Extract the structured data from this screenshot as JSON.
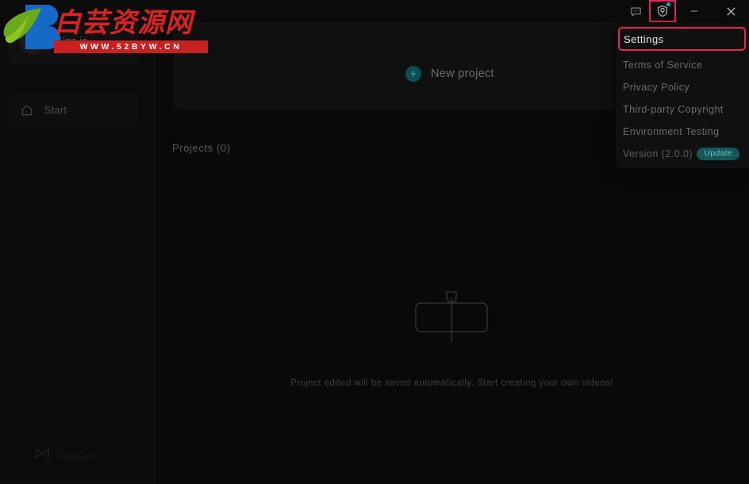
{
  "window": {
    "titlebar": {
      "feedback_icon": "chat-bubble-icon",
      "help_icon": "help-shield-icon",
      "minimize_label": "—",
      "close_label": "✕",
      "help_has_notification": true
    }
  },
  "sidebar": {
    "account": {
      "label": "Sign in",
      "avatar_icon": "avatar-icon"
    },
    "items": [
      {
        "label": "Start",
        "icon": "home-icon",
        "active": true
      }
    ],
    "footer_brand": {
      "label": "CapCut",
      "icon": "capcut-logo-icon"
    }
  },
  "main": {
    "new_project": {
      "label": "New project",
      "icon": "plus-circle-icon"
    },
    "projects_header": "Projects (0)",
    "empty_state": {
      "icon": "empty-project-icon",
      "message": "Project edited will be saved automatically. Start creating your own videos!"
    }
  },
  "dropdown": {
    "items": [
      {
        "label": "Settings",
        "highlighted": true
      },
      {
        "label": "Terms of Service",
        "highlighted": false
      },
      {
        "label": "Privacy Policy",
        "highlighted": false
      },
      {
        "label": "Third-party Copyright",
        "highlighted": false
      },
      {
        "label": "Environment Testing",
        "highlighted": false
      }
    ],
    "version": {
      "label": "Version (2.0.0)",
      "badge": "Update"
    }
  },
  "watermark": {
    "title": "白芸资源网",
    "url": "WWW.52BYW.CN",
    "logo_icon": "byw-leaf-b-logo-icon"
  },
  "colors": {
    "accent_teal": "#1ea9a0",
    "highlight_red": "#e8245a",
    "watermark_red": "#c92020",
    "background": "#0a0a0a"
  }
}
